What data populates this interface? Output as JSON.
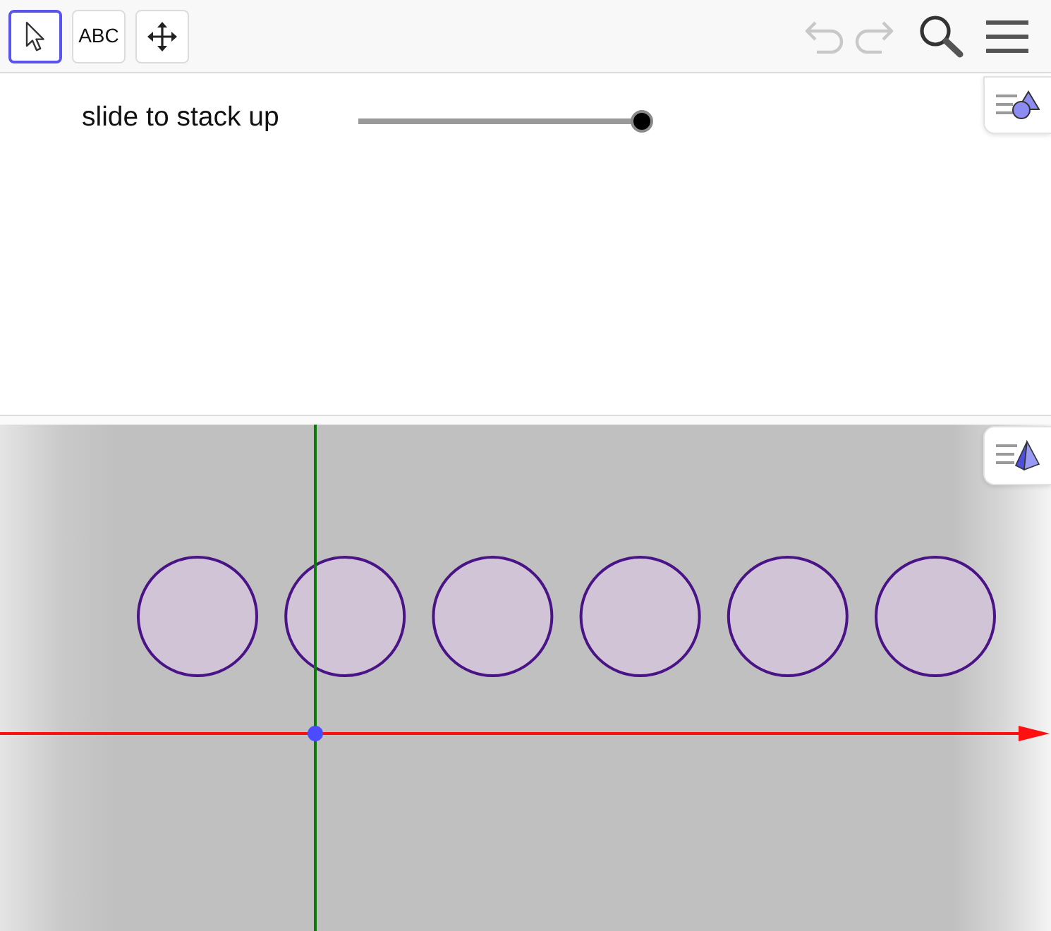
{
  "toolbar": {
    "tools": [
      {
        "kind": "select",
        "selected": true
      },
      {
        "kind": "text",
        "label": "ABC",
        "selected": false
      },
      {
        "kind": "move",
        "selected": false
      }
    ],
    "actions": [
      {
        "kind": "undo",
        "disabled": true
      },
      {
        "kind": "redo",
        "disabled": true
      },
      {
        "kind": "search"
      },
      {
        "kind": "menu"
      }
    ]
  },
  "graphics_view": {
    "slider": {
      "label": "slide to stack up",
      "level": 1
    }
  },
  "graphics_3d_view": {
    "objects": [
      {
        "kind": "circle"
      },
      {
        "kind": "circle"
      },
      {
        "kind": "circle"
      },
      {
        "kind": "circle"
      },
      {
        "kind": "circle"
      },
      {
        "kind": "circle"
      },
      {
        "kind": "x-axis"
      },
      {
        "kind": "y-axis"
      },
      {
        "kind": "point"
      }
    ]
  }
}
